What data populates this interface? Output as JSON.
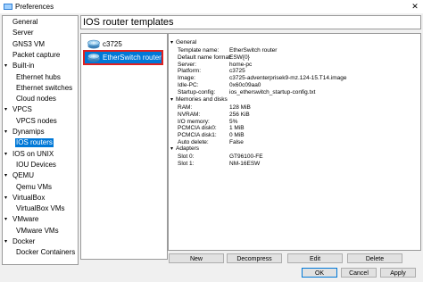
{
  "window": {
    "title": "Preferences",
    "close_glyph": "✕",
    "app_icon": "gns3-icon"
  },
  "sidebar": {
    "items": [
      {
        "label": "General",
        "level": 0,
        "expandable": false
      },
      {
        "label": "Server",
        "level": 0,
        "expandable": false
      },
      {
        "label": "GNS3 VM",
        "level": 0,
        "expandable": false
      },
      {
        "label": "Packet capture",
        "level": 0,
        "expandable": false
      },
      {
        "label": "Built-in",
        "level": 0,
        "expandable": true
      },
      {
        "label": "Ethernet hubs",
        "level": 1,
        "expandable": false
      },
      {
        "label": "Ethernet switches",
        "level": 1,
        "expandable": false
      },
      {
        "label": "Cloud nodes",
        "level": 1,
        "expandable": false
      },
      {
        "label": "VPCS",
        "level": 0,
        "expandable": true
      },
      {
        "label": "VPCS nodes",
        "level": 1,
        "expandable": false
      },
      {
        "label": "Dynamips",
        "level": 0,
        "expandable": true
      },
      {
        "label": "IOS routers",
        "level": 1,
        "expandable": false,
        "selected": true
      },
      {
        "label": "IOS on UNIX",
        "level": 0,
        "expandable": true
      },
      {
        "label": "IOU Devices",
        "level": 1,
        "expandable": false
      },
      {
        "label": "QEMU",
        "level": 0,
        "expandable": true
      },
      {
        "label": "Qemu VMs",
        "level": 1,
        "expandable": false
      },
      {
        "label": "VirtualBox",
        "level": 0,
        "expandable": true
      },
      {
        "label": "VirtualBox VMs",
        "level": 1,
        "expandable": false
      },
      {
        "label": "VMware",
        "level": 0,
        "expandable": true
      },
      {
        "label": "VMware VMs",
        "level": 1,
        "expandable": false
      },
      {
        "label": "Docker",
        "level": 0,
        "expandable": true
      },
      {
        "label": "Docker Containers",
        "level": 1,
        "expandable": false
      }
    ]
  },
  "main": {
    "heading": "IOS router templates",
    "routers": [
      {
        "label": "c3725",
        "icon": "router-icon",
        "selected": false
      },
      {
        "label": "EtherSwitch router",
        "icon": "router-icon",
        "selected": true
      }
    ],
    "properties": {
      "general": {
        "title": "General",
        "rows": [
          {
            "key": "Template name:",
            "value": "EtherSwitch router"
          },
          {
            "key": "Default name format:",
            "value": "ESW{0}"
          },
          {
            "key": "Server:",
            "value": "home-pc"
          },
          {
            "key": "Platform:",
            "value": "c3725"
          },
          {
            "key": "Image:",
            "value": "c3725-adventerprisek9-mz.124-15.T14.image"
          },
          {
            "key": "Idle-PC:",
            "value": "0x60c09aa0"
          },
          {
            "key": "Startup-config:",
            "value": "ios_etherswitch_startup-config.txt"
          }
        ]
      },
      "memories": {
        "title": "Memories and disks",
        "rows": [
          {
            "key": "RAM:",
            "value": "128 MiB"
          },
          {
            "key": "NVRAM:",
            "value": "256 KiB"
          },
          {
            "key": "I/O memory:",
            "value": "5%"
          },
          {
            "key": "PCMCIA disk0:",
            "value": "1 MiB"
          },
          {
            "key": "PCMCIA disk1:",
            "value": "0 MiB"
          },
          {
            "key": "Auto delete:",
            "value": "False"
          }
        ]
      },
      "adapters": {
        "title": "Adapters",
        "rows": [
          {
            "key": "Slot 0:",
            "value": "GT96100-FE"
          },
          {
            "key": "Slot 1:",
            "value": "NM-16ESW"
          }
        ]
      }
    },
    "actions": {
      "new": "New",
      "decompress": "Decompress",
      "edit": "Edit",
      "delete": "Delete"
    }
  },
  "footer": {
    "ok": "OK",
    "cancel": "Cancel",
    "apply": "Apply"
  },
  "colors": {
    "selection": "#0078d7",
    "highlight_border": "#e02020"
  }
}
